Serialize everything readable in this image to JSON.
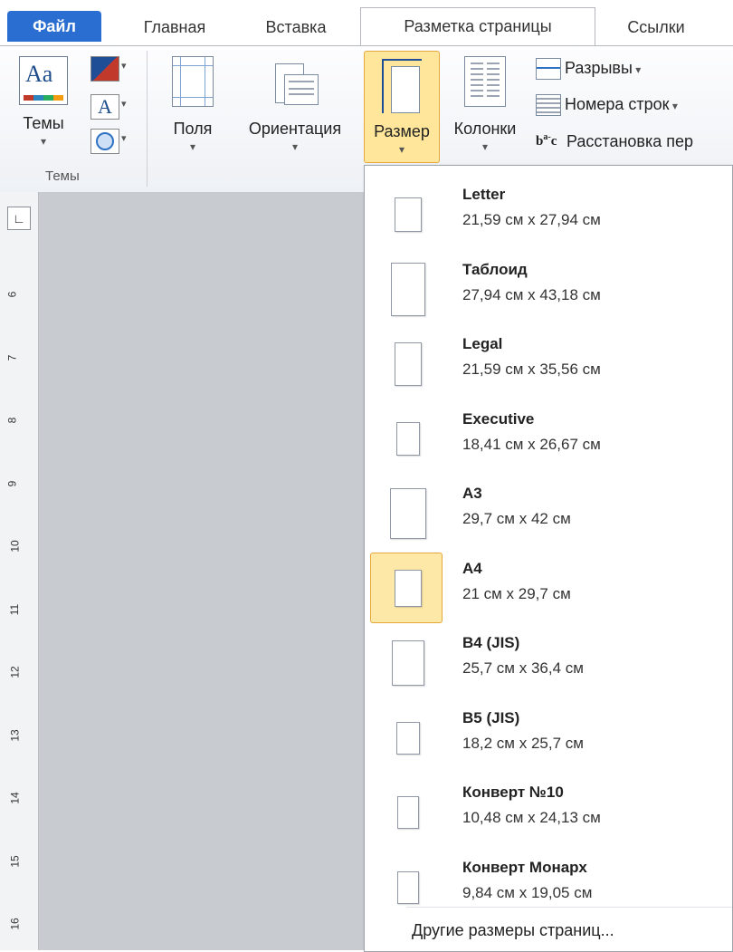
{
  "tabs": [
    "Файл",
    "Главная",
    "Вставка",
    "Разметка страницы",
    "Ссылки"
  ],
  "ribbon": {
    "themes_label": "Темы",
    "themes_group_label": "Темы",
    "margins_label": "Поля",
    "orientation_label": "Ориентация",
    "size_label": "Размер",
    "columns_label": "Колонки",
    "breaks_label": "Разрывы",
    "line_numbers_label": "Номера строк",
    "hyphenation_label": "Расстановка пер"
  },
  "ruler": {
    "numbers": [
      "6",
      "7",
      "8",
      "9",
      "10",
      "11",
      "12",
      "13",
      "14",
      "15",
      "16"
    ]
  },
  "sizes": [
    {
      "name": "Letter",
      "dims": "21,59 см x 27,94 см",
      "ratio": [
        21.59,
        27.94
      ]
    },
    {
      "name": "Таблоид",
      "dims": "27,94 см x 43,18 см",
      "ratio": [
        27.94,
        43.18
      ]
    },
    {
      "name": "Legal",
      "dims": "21,59 см x 35,56 см",
      "ratio": [
        21.59,
        35.56
      ]
    },
    {
      "name": "Executive",
      "dims": "18,41 см x 26,67 см",
      "ratio": [
        18.41,
        26.67
      ]
    },
    {
      "name": "A3",
      "dims": "29,7 см x 42 см",
      "ratio": [
        29.7,
        42
      ]
    },
    {
      "name": "A4",
      "dims": "21 см x 29,7 см",
      "ratio": [
        21,
        29.7
      ],
      "selected": true
    },
    {
      "name": "B4 (JIS)",
      "dims": "25,7 см x 36,4 см",
      "ratio": [
        25.7,
        36.4
      ]
    },
    {
      "name": "B5 (JIS)",
      "dims": "18,2 см x 25,7 см",
      "ratio": [
        18.2,
        25.7
      ]
    },
    {
      "name": "Конверт №10",
      "dims": "10,48 см x 24,13 см",
      "ratio": [
        10.48,
        24.13
      ]
    },
    {
      "name": "Конверт Монарх",
      "dims": "9,84 см x 19,05 см",
      "ratio": [
        9.84,
        19.05
      ]
    }
  ],
  "more_sizes": "Другие размеры страниц...",
  "colors": {
    "file_tab": "#2b6ed1",
    "selected_bg": "#fde8a8",
    "selected_border": "#e5a63a"
  }
}
